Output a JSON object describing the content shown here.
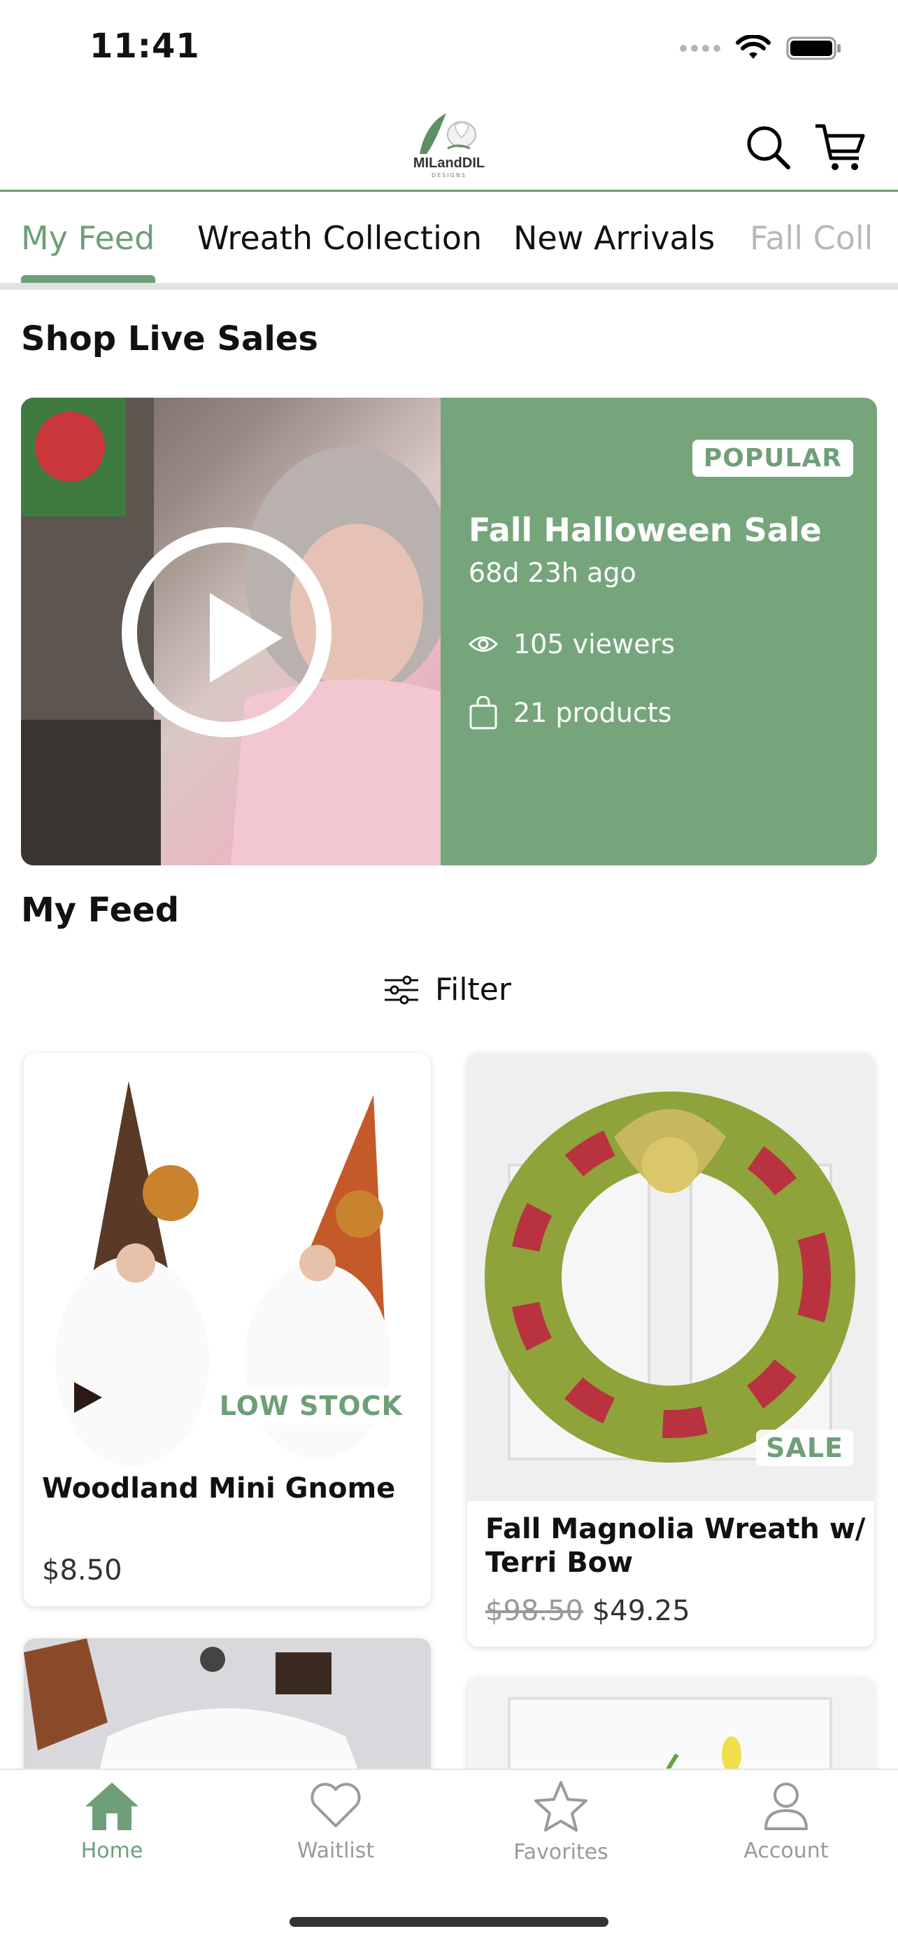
{
  "status_bar": {
    "time": "11:41"
  },
  "header": {
    "logo_text": "MILandDIL",
    "logo_sub": "DESIGNS",
    "search_icon": "search-icon",
    "cart_icon": "cart-icon"
  },
  "tabs": [
    {
      "label": "My Feed",
      "active": true
    },
    {
      "label": "Wreath Collection"
    },
    {
      "label": "New Arrivals"
    },
    {
      "label": "Fall Coll"
    }
  ],
  "live_section": {
    "title": "Shop Live Sales",
    "sale": {
      "badge": "POPULAR",
      "title": "Fall Halloween Sale",
      "ago": "68d 23h ago",
      "viewers": "105 viewers",
      "products": "21 products"
    }
  },
  "feed": {
    "title": "My Feed",
    "filter_label": "Filter",
    "products": [
      {
        "name": "Woodland Mini Gnome",
        "badge": "LOW STOCK",
        "price": "$8.50"
      },
      {
        "name_line1": "Fall Magnolia Wreath w/",
        "name_line2": "Terri Bow",
        "badge": "SALE",
        "old_price": "$98.50",
        "price": "$49.25"
      }
    ]
  },
  "bottom_nav": [
    {
      "label": "Home",
      "icon": "home-icon",
      "active": true
    },
    {
      "label": "Waitlist",
      "icon": "heart-icon"
    },
    {
      "label": "Favorites",
      "icon": "star-icon"
    },
    {
      "label": "Account",
      "icon": "person-icon"
    }
  ],
  "colors": {
    "accent": "#6e9f78",
    "live_card": "#76a57c"
  }
}
